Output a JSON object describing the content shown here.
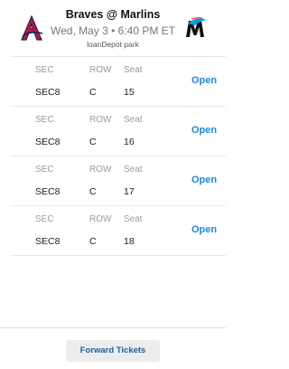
{
  "event": {
    "title": "Braves @ Marlins",
    "datetime": "Wed, May 3 • 6:40 PM ET",
    "venue": "loanDepot park"
  },
  "tickets": {
    "labels": {
      "sec": "SEC",
      "row": "ROW",
      "seat": "Seat"
    },
    "open_label": "Open",
    "items": [
      {
        "sec": "SEC8",
        "row": "C",
        "seat": "15"
      },
      {
        "sec": "SEC8",
        "row": "C",
        "seat": "16"
      },
      {
        "sec": "SEC8",
        "row": "C",
        "seat": "17"
      },
      {
        "sec": "SEC8",
        "row": "C",
        "seat": "18"
      }
    ]
  },
  "footer": {
    "forward_label": "Forward Tickets"
  },
  "colors": {
    "accent": "#1e88d0",
    "braves_red": "#ce1141",
    "marlins_teal": "#00a3e0"
  },
  "icons": {
    "away_logo": "braves-logo-icon",
    "home_logo": "marlins-logo-icon"
  }
}
